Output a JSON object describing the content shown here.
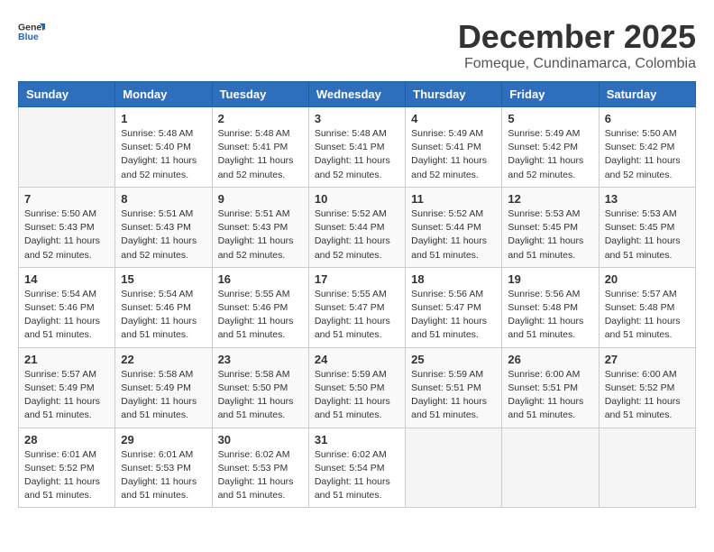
{
  "header": {
    "logo_general": "General",
    "logo_blue": "Blue",
    "month_year": "December 2025",
    "location": "Fomeque, Cundinamarca, Colombia"
  },
  "weekdays": [
    "Sunday",
    "Monday",
    "Tuesday",
    "Wednesday",
    "Thursday",
    "Friday",
    "Saturday"
  ],
  "weeks": [
    [
      {
        "day": "",
        "info": ""
      },
      {
        "day": "1",
        "info": "Sunrise: 5:48 AM\nSunset: 5:40 PM\nDaylight: 11 hours\nand 52 minutes."
      },
      {
        "day": "2",
        "info": "Sunrise: 5:48 AM\nSunset: 5:41 PM\nDaylight: 11 hours\nand 52 minutes."
      },
      {
        "day": "3",
        "info": "Sunrise: 5:48 AM\nSunset: 5:41 PM\nDaylight: 11 hours\nand 52 minutes."
      },
      {
        "day": "4",
        "info": "Sunrise: 5:49 AM\nSunset: 5:41 PM\nDaylight: 11 hours\nand 52 minutes."
      },
      {
        "day": "5",
        "info": "Sunrise: 5:49 AM\nSunset: 5:42 PM\nDaylight: 11 hours\nand 52 minutes."
      },
      {
        "day": "6",
        "info": "Sunrise: 5:50 AM\nSunset: 5:42 PM\nDaylight: 11 hours\nand 52 minutes."
      }
    ],
    [
      {
        "day": "7",
        "info": "Sunrise: 5:50 AM\nSunset: 5:43 PM\nDaylight: 11 hours\nand 52 minutes."
      },
      {
        "day": "8",
        "info": "Sunrise: 5:51 AM\nSunset: 5:43 PM\nDaylight: 11 hours\nand 52 minutes."
      },
      {
        "day": "9",
        "info": "Sunrise: 5:51 AM\nSunset: 5:43 PM\nDaylight: 11 hours\nand 52 minutes."
      },
      {
        "day": "10",
        "info": "Sunrise: 5:52 AM\nSunset: 5:44 PM\nDaylight: 11 hours\nand 52 minutes."
      },
      {
        "day": "11",
        "info": "Sunrise: 5:52 AM\nSunset: 5:44 PM\nDaylight: 11 hours\nand 51 minutes."
      },
      {
        "day": "12",
        "info": "Sunrise: 5:53 AM\nSunset: 5:45 PM\nDaylight: 11 hours\nand 51 minutes."
      },
      {
        "day": "13",
        "info": "Sunrise: 5:53 AM\nSunset: 5:45 PM\nDaylight: 11 hours\nand 51 minutes."
      }
    ],
    [
      {
        "day": "14",
        "info": "Sunrise: 5:54 AM\nSunset: 5:46 PM\nDaylight: 11 hours\nand 51 minutes."
      },
      {
        "day": "15",
        "info": "Sunrise: 5:54 AM\nSunset: 5:46 PM\nDaylight: 11 hours\nand 51 minutes."
      },
      {
        "day": "16",
        "info": "Sunrise: 5:55 AM\nSunset: 5:46 PM\nDaylight: 11 hours\nand 51 minutes."
      },
      {
        "day": "17",
        "info": "Sunrise: 5:55 AM\nSunset: 5:47 PM\nDaylight: 11 hours\nand 51 minutes."
      },
      {
        "day": "18",
        "info": "Sunrise: 5:56 AM\nSunset: 5:47 PM\nDaylight: 11 hours\nand 51 minutes."
      },
      {
        "day": "19",
        "info": "Sunrise: 5:56 AM\nSunset: 5:48 PM\nDaylight: 11 hours\nand 51 minutes."
      },
      {
        "day": "20",
        "info": "Sunrise: 5:57 AM\nSunset: 5:48 PM\nDaylight: 11 hours\nand 51 minutes."
      }
    ],
    [
      {
        "day": "21",
        "info": "Sunrise: 5:57 AM\nSunset: 5:49 PM\nDaylight: 11 hours\nand 51 minutes."
      },
      {
        "day": "22",
        "info": "Sunrise: 5:58 AM\nSunset: 5:49 PM\nDaylight: 11 hours\nand 51 minutes."
      },
      {
        "day": "23",
        "info": "Sunrise: 5:58 AM\nSunset: 5:50 PM\nDaylight: 11 hours\nand 51 minutes."
      },
      {
        "day": "24",
        "info": "Sunrise: 5:59 AM\nSunset: 5:50 PM\nDaylight: 11 hours\nand 51 minutes."
      },
      {
        "day": "25",
        "info": "Sunrise: 5:59 AM\nSunset: 5:51 PM\nDaylight: 11 hours\nand 51 minutes."
      },
      {
        "day": "26",
        "info": "Sunrise: 6:00 AM\nSunset: 5:51 PM\nDaylight: 11 hours\nand 51 minutes."
      },
      {
        "day": "27",
        "info": "Sunrise: 6:00 AM\nSunset: 5:52 PM\nDaylight: 11 hours\nand 51 minutes."
      }
    ],
    [
      {
        "day": "28",
        "info": "Sunrise: 6:01 AM\nSunset: 5:52 PM\nDaylight: 11 hours\nand 51 minutes."
      },
      {
        "day": "29",
        "info": "Sunrise: 6:01 AM\nSunset: 5:53 PM\nDaylight: 11 hours\nand 51 minutes."
      },
      {
        "day": "30",
        "info": "Sunrise: 6:02 AM\nSunset: 5:53 PM\nDaylight: 11 hours\nand 51 minutes."
      },
      {
        "day": "31",
        "info": "Sunrise: 6:02 AM\nSunset: 5:54 PM\nDaylight: 11 hours\nand 51 minutes."
      },
      {
        "day": "",
        "info": ""
      },
      {
        "day": "",
        "info": ""
      },
      {
        "day": "",
        "info": ""
      }
    ]
  ]
}
